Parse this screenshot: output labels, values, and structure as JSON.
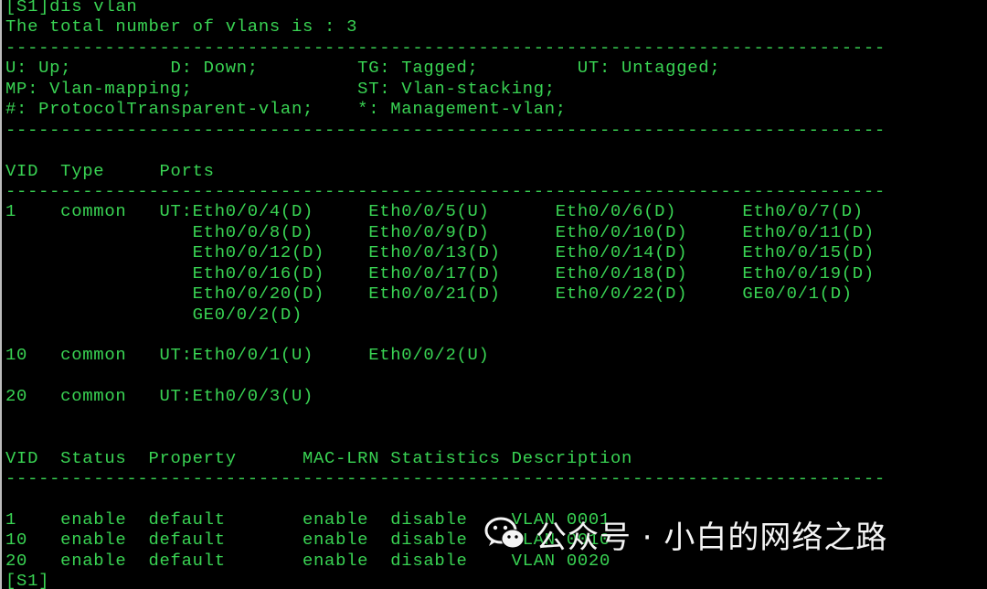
{
  "terminal": {
    "foreground": "#39d353",
    "background": "#000000",
    "lines": [
      "[S1]dis vlan",
      "The total number of vlans is : 3",
      "--------------------------------------------------------------------------------",
      "U: Up;         D: Down;         TG: Tagged;         UT: Untagged;",
      "MP: Vlan-mapping;               ST: Vlan-stacking;",
      "#: ProtocolTransparent-vlan;    *: Management-vlan;",
      "--------------------------------------------------------------------------------",
      "",
      "VID  Type     Ports",
      "--------------------------------------------------------------------------------",
      "1    common   UT:Eth0/0/4(D)     Eth0/0/5(U)      Eth0/0/6(D)      Eth0/0/7(D)",
      "                 Eth0/0/8(D)     Eth0/0/9(D)      Eth0/0/10(D)     Eth0/0/11(D)",
      "                 Eth0/0/12(D)    Eth0/0/13(D)     Eth0/0/14(D)     Eth0/0/15(D)",
      "                 Eth0/0/16(D)    Eth0/0/17(D)     Eth0/0/18(D)     Eth0/0/19(D)",
      "                 Eth0/0/20(D)    Eth0/0/21(D)     Eth0/0/22(D)     GE0/0/1(D)",
      "                 GE0/0/2(D)",
      "",
      "10   common   UT:Eth0/0/1(U)     Eth0/0/2(U)",
      "",
      "20   common   UT:Eth0/0/3(U)",
      "",
      "",
      "VID  Status  Property      MAC-LRN Statistics Description",
      "--------------------------------------------------------------------------------",
      "",
      "1    enable  default       enable  disable    VLAN 0001",
      "10   enable  default       enable  disable    VLAN 0010",
      "20   enable  default       enable  disable    VLAN 0020",
      "[S1]"
    ]
  },
  "watermark": {
    "text": "公众号 · 小白的网络之路",
    "icon": "wechat-icon"
  }
}
